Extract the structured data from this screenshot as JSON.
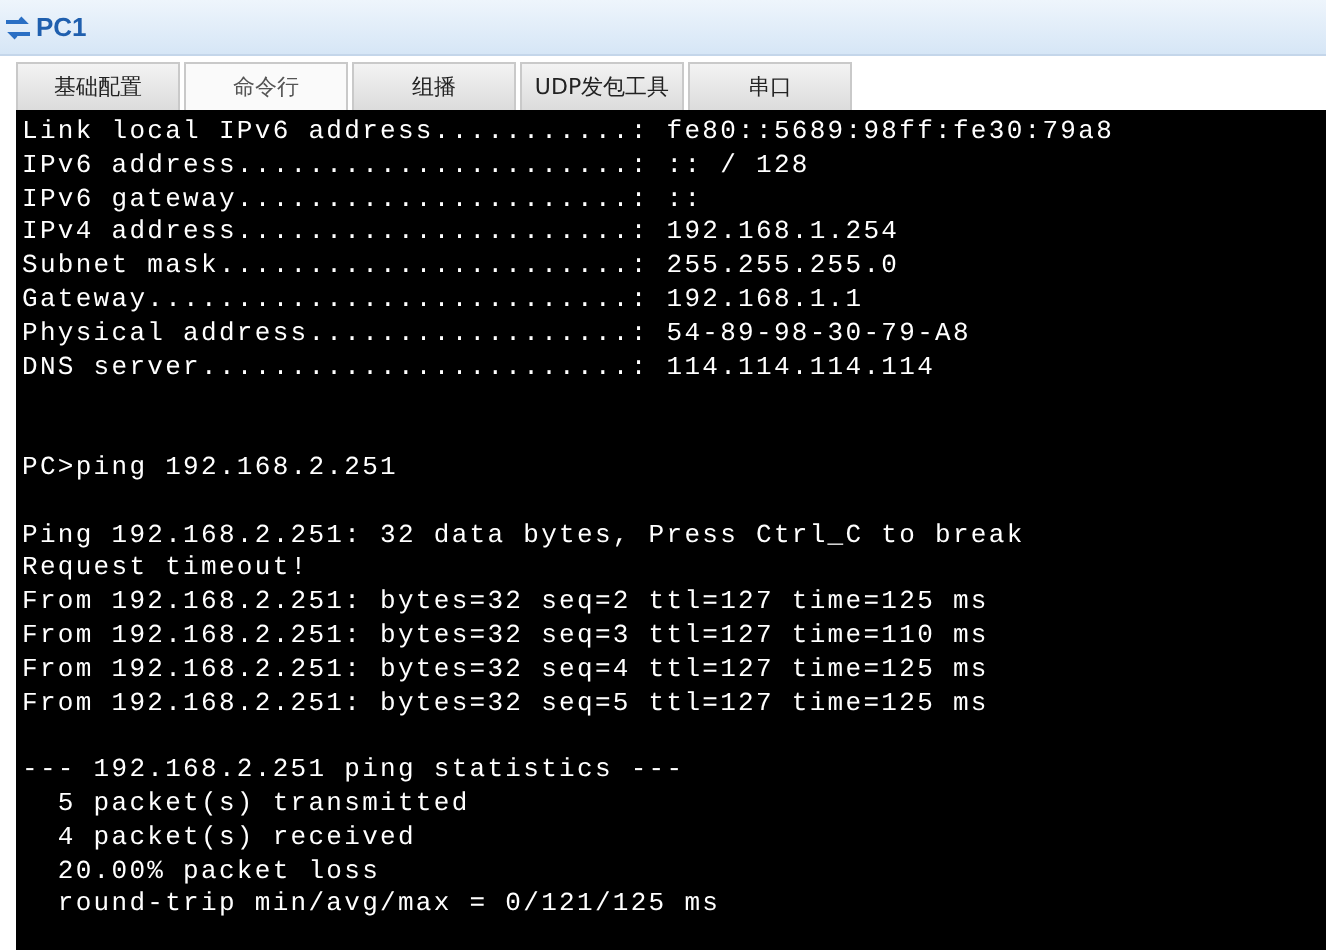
{
  "window": {
    "title": "PC1"
  },
  "tabs": [
    {
      "label": "基础配置",
      "selected": false
    },
    {
      "label": "命令行",
      "selected": true
    },
    {
      "label": "组播",
      "selected": false
    },
    {
      "label": "UDP发包工具",
      "selected": false
    },
    {
      "label": "串口",
      "selected": false
    }
  ],
  "terminal_lines": [
    {
      "kind": "text",
      "text": "Link local IPv6 address...........: fe80::5689:98ff:fe30:79a8"
    },
    {
      "kind": "text",
      "text": "IPv6 address......................: :: / 128"
    },
    {
      "kind": "text",
      "text": "IPv6 gateway......................: ::"
    },
    {
      "kind": "text",
      "text": "IPv4 address......................: 192.168.1.254"
    },
    {
      "kind": "text",
      "text": "Subnet mask.......................: 255.255.255.0"
    },
    {
      "kind": "text",
      "text": "Gateway...........................: 192.168.1.1"
    },
    {
      "kind": "text",
      "text": "Physical address..................: 54-89-98-30-79-A8"
    },
    {
      "kind": "text",
      "text": "DNS server........................: 114.114.114.114"
    },
    {
      "kind": "blank"
    },
    {
      "kind": "blank"
    },
    {
      "kind": "text",
      "text": "PC>ping 192.168.2.251"
    },
    {
      "kind": "blank"
    },
    {
      "kind": "text",
      "text": "Ping 192.168.2.251: 32 data bytes, Press Ctrl_C to break"
    },
    {
      "kind": "text",
      "text": "Request timeout!"
    },
    {
      "kind": "text",
      "text": "From 192.168.2.251: bytes=32 seq=2 ttl=127 time=125 ms"
    },
    {
      "kind": "text",
      "text": "From 192.168.2.251: bytes=32 seq=3 ttl=127 time=110 ms"
    },
    {
      "kind": "text",
      "text": "From 192.168.2.251: bytes=32 seq=4 ttl=127 time=125 ms"
    },
    {
      "kind": "text",
      "text": "From 192.168.2.251: bytes=32 seq=5 ttl=127 time=125 ms"
    },
    {
      "kind": "blank"
    },
    {
      "kind": "text",
      "text": "--- 192.168.2.251 ping statistics ---"
    },
    {
      "kind": "text",
      "text": "  5 packet(s) transmitted"
    },
    {
      "kind": "text",
      "text": "  4 packet(s) received"
    },
    {
      "kind": "text",
      "text": "  20.00% packet loss"
    },
    {
      "kind": "text",
      "text": "  round-trip min/avg/max = 0/121/125 ms"
    }
  ]
}
